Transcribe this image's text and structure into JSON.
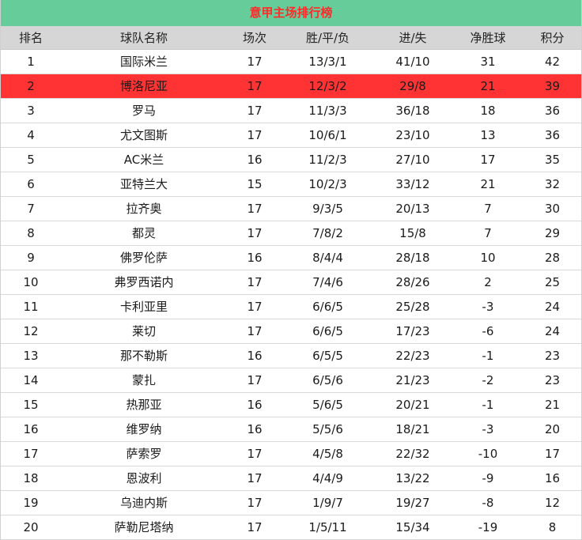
{
  "title": "意甲主场排行榜",
  "colors": {
    "title_bg": "#66cc99",
    "title_text": "#ff2a2a",
    "header_bg": "#d6d6d6",
    "highlight_row": "#ff3333"
  },
  "headers": [
    "排名",
    "球队名称",
    "场次",
    "胜/平/负",
    "进/失",
    "净胜球",
    "积分"
  ],
  "rows": [
    [
      "1",
      "国际米兰",
      "17",
      "13/3/1",
      "41/10",
      "31",
      "42"
    ],
    [
      "2",
      "博洛尼亚",
      "17",
      "12/3/2",
      "29/8",
      "21",
      "39"
    ],
    [
      "3",
      "罗马",
      "17",
      "11/3/3",
      "36/18",
      "18",
      "36"
    ],
    [
      "4",
      "尤文图斯",
      "17",
      "10/6/1",
      "23/10",
      "13",
      "36"
    ],
    [
      "5",
      "AC米兰",
      "16",
      "11/2/3",
      "27/10",
      "17",
      "35"
    ],
    [
      "6",
      "亚特兰大",
      "15",
      "10/2/3",
      "33/12",
      "21",
      "32"
    ],
    [
      "7",
      "拉齐奥",
      "17",
      "9/3/5",
      "20/13",
      "7",
      "30"
    ],
    [
      "8",
      "都灵",
      "17",
      "7/8/2",
      "15/8",
      "7",
      "29"
    ],
    [
      "9",
      "佛罗伦萨",
      "16",
      "8/4/4",
      "28/18",
      "10",
      "28"
    ],
    [
      "10",
      "弗罗西诺内",
      "17",
      "7/4/6",
      "28/26",
      "2",
      "25"
    ],
    [
      "11",
      "卡利亚里",
      "17",
      "6/6/5",
      "25/28",
      "-3",
      "24"
    ],
    [
      "12",
      "莱切",
      "17",
      "6/6/5",
      "17/23",
      "-6",
      "24"
    ],
    [
      "13",
      "那不勒斯",
      "16",
      "6/5/5",
      "22/23",
      "-1",
      "23"
    ],
    [
      "14",
      "蒙扎",
      "17",
      "6/5/6",
      "21/23",
      "-2",
      "23"
    ],
    [
      "15",
      "热那亚",
      "16",
      "5/6/5",
      "20/21",
      "-1",
      "21"
    ],
    [
      "16",
      "维罗纳",
      "16",
      "5/5/6",
      "18/21",
      "-3",
      "20"
    ],
    [
      "17",
      "萨索罗",
      "17",
      "4/5/8",
      "22/32",
      "-10",
      "17"
    ],
    [
      "18",
      "恩波利",
      "17",
      "4/4/9",
      "13/22",
      "-9",
      "16"
    ],
    [
      "19",
      "乌迪内斯",
      "17",
      "1/9/7",
      "19/27",
      "-8",
      "12"
    ],
    [
      "20",
      "萨勒尼塔纳",
      "17",
      "1/5/11",
      "15/34",
      "-19",
      "8"
    ]
  ],
  "highlight_index": 1
}
